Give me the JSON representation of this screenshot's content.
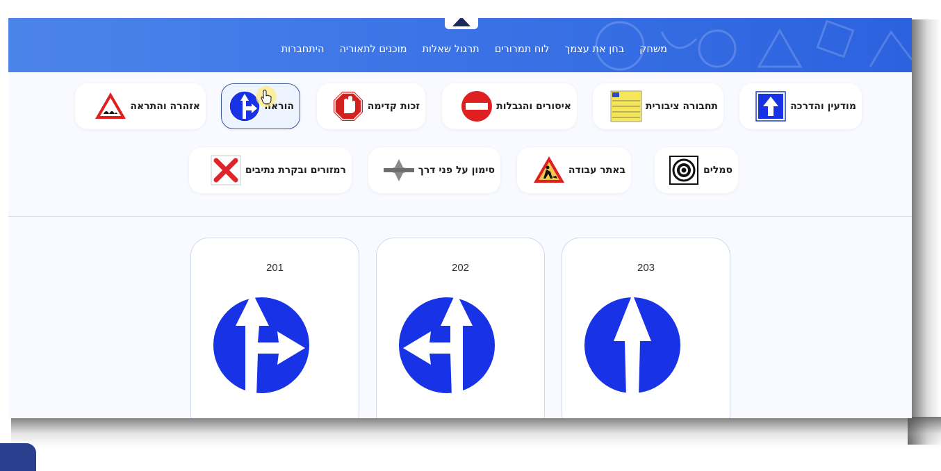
{
  "nav": {
    "items": [
      "משחק",
      "בחן את עצמך",
      "לוח תמרורים",
      "תרגול שאלות",
      "מוכנים לתאוריה",
      "היתחברות"
    ]
  },
  "categories": {
    "row1": [
      {
        "label": "מודעין והדרכה",
        "icon": "information-sign-icon"
      },
      {
        "label": "תחבורה ציבורית",
        "icon": "bus-timetable-icon"
      },
      {
        "label": "איסורים והגבלות",
        "icon": "no-entry-icon"
      },
      {
        "label": "זכות קדימה",
        "icon": "stop-hand-icon"
      },
      {
        "label": "הוראה",
        "icon": "mandatory-direction-icon",
        "active": true
      },
      {
        "label": "אזהרה והתראה",
        "icon": "warning-triangle-icon"
      }
    ],
    "row2": [
      {
        "label": "סמלים",
        "icon": "target-symbol-icon"
      },
      {
        "label": "באתר עבודה",
        "icon": "roadworks-icon"
      },
      {
        "label": "סימון על פני דרך",
        "icon": "road-marking-icon"
      },
      {
        "label": "רמזורים ובקרת נתיבים",
        "icon": "lane-closed-x-icon"
      }
    ]
  },
  "signs": [
    {
      "number": "201",
      "icon": "straight-or-right-sign-icon"
    },
    {
      "number": "202",
      "icon": "straight-or-left-sign-icon"
    },
    {
      "number": "203",
      "icon": "straight-only-sign-icon"
    }
  ],
  "colors": {
    "header_blue": "#3b73e6",
    "sign_blue": "#1833e6",
    "accent_navy": "#2b3f8f"
  }
}
